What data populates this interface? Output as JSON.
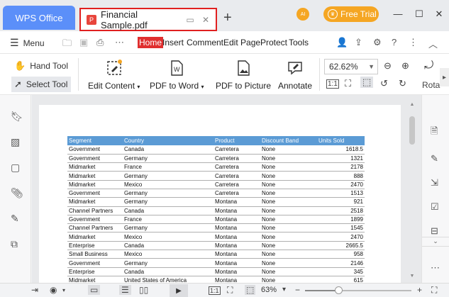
{
  "titlebar": {
    "home_tab": "WPS Office",
    "doc_tab": "Financial Sample.pdf",
    "new_tab": "+",
    "ai_badge": "AI",
    "free_trial": "Free Trial",
    "minimize": "—",
    "maximize": "☐",
    "close": "✕"
  },
  "menubar": {
    "menu_label": "Menu",
    "tabs": [
      "Home",
      "Insert",
      "Comment",
      "Edit Page",
      "Protect",
      "Tools"
    ],
    "active_tab": "Home"
  },
  "ribbon": {
    "hand_tool": "Hand Tool",
    "select_tool": "Select Tool",
    "edit_content": "Edit Content",
    "pdf_to_word": "PDF to Word",
    "pdf_to_picture": "PDF to Picture",
    "annotate": "Annotate",
    "zoom": "62.62%",
    "rotate": "Rota"
  },
  "table": {
    "headers": [
      "Segment",
      "Country",
      "Product",
      "Discount Band",
      "Units Sold"
    ],
    "rows": [
      [
        "Government",
        "Canada",
        "Carretera",
        "None",
        "1618.5"
      ],
      [
        "Government",
        "Germany",
        "Carretera",
        "None",
        "1321"
      ],
      [
        "Midmarket",
        "France",
        "Carretera",
        "None",
        "2178"
      ],
      [
        "Midmarket",
        "Germany",
        "Carretera",
        "None",
        "888"
      ],
      [
        "Midmarket",
        "Mexico",
        "Carretera",
        "None",
        "2470"
      ],
      [
        "Government",
        "Germany",
        "Carretera",
        "None",
        "1513"
      ],
      [
        "Midmarket",
        "Germany",
        "Montana",
        "None",
        "921"
      ],
      [
        "Channel Partners",
        "Canada",
        "Montana",
        "None",
        "2518"
      ],
      [
        "Government",
        "France",
        "Montana",
        "None",
        "1899"
      ],
      [
        "Channel Partners",
        "Germany",
        "Montana",
        "None",
        "1545"
      ],
      [
        "Midmarket",
        "Mexico",
        "Montana",
        "None",
        "2470"
      ],
      [
        "Enterprise",
        "Canada",
        "Montana",
        "None",
        "2665.5"
      ],
      [
        "Small Business",
        "Mexico",
        "Montana",
        "None",
        "958"
      ],
      [
        "Government",
        "Germany",
        "Montana",
        "None",
        "2146"
      ],
      [
        "Enterprise",
        "Canada",
        "Montana",
        "None",
        "345"
      ],
      [
        "Midmarket",
        "United States of America",
        "Montana",
        "None",
        "615"
      ]
    ]
  },
  "statusbar": {
    "zoom": "63%",
    "zoom_fraction": 0.31
  },
  "colors": {
    "accent_blue": "#5b8ff9",
    "home_red": "#e02f2f",
    "trial_orange": "#f5a623",
    "table_header": "#5b9bd5"
  }
}
